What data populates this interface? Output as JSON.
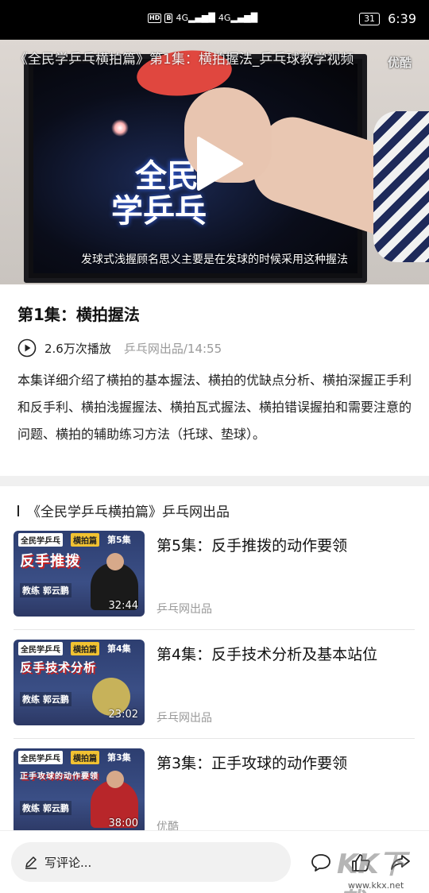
{
  "status_bar": {
    "net_tag": "HD",
    "net_tag2": "B",
    "signal1": "4G",
    "signal2": "4G",
    "battery": "31",
    "time": "6:39"
  },
  "video": {
    "title": "《全民学乒乓横拍篇》第1集：横拍握法_乒乓球教学视频",
    "watermark": "优酷",
    "logo_text_1": "全民",
    "logo_text_2": "学乒乓",
    "subtitle": "发球式浅握顾名思义主要是在发球的时候采用这种握法"
  },
  "episode": {
    "title": "第1集：横拍握法",
    "plays": "2.6万次播放",
    "source": "乒乓网出品/14:55",
    "description": "本集详细介绍了横拍的基本握法、横拍的优缺点分析、横拍深握正手利和反手利、横拍浅握握法、横拍瓦式握法、横拍错误握拍和需要注意的问题、横拍的辅助练习方法（托球、垫球）。"
  },
  "playlist": {
    "header": "《全民学乒乓横拍篇》乒乓网出品",
    "items": [
      {
        "title": "第5集：反手推拨的动作要领",
        "source": "乒乓网出品",
        "duration": "32:44",
        "thumb_series": "全民学乒乓",
        "thumb_tag": "横拍篇",
        "thumb_ep": "第5集",
        "thumb_big": "反手推拨",
        "thumb_coach": "教练 郭云鹏"
      },
      {
        "title": "第4集：反手技术分析及基本站位",
        "source": "乒乓网出品",
        "duration": "23:02",
        "thumb_series": "全民学乒乓",
        "thumb_tag": "横拍篇",
        "thumb_ep": "第4集",
        "thumb_big": "反手技术分析",
        "thumb_coach": "教练 郭云鹏"
      },
      {
        "title": "第3集：正手攻球的动作要领",
        "source": "优酷",
        "duration": "38:00",
        "thumb_series": "全民学乒乓",
        "thumb_tag": "横拍篇",
        "thumb_ep": "第3集",
        "thumb_big": "正手攻球的动作要领",
        "thumb_coach": "教练 郭云鹏"
      }
    ]
  },
  "bottom_bar": {
    "comment_placeholder": "写评论...",
    "watermark": "KK下载",
    "watermark_url": "www.kkx.net"
  }
}
